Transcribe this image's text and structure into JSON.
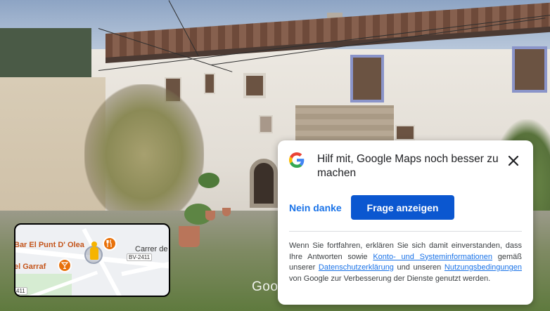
{
  "street_view": {
    "watermark": "Google"
  },
  "minimap": {
    "labels": {
      "bar_name": "Bar El Punt D' Olea",
      "garraf": "el Garraf",
      "street": "Carrer de",
      "road_badge": "BV-2411",
      "road_badge_left": "411"
    },
    "pin_icons": [
      "restaurant-icon",
      "bar-icon"
    ]
  },
  "dialog": {
    "title": "Hilf mit, Google Maps noch besser zu machen",
    "decline_label": "Nein danke",
    "accept_label": "Frage anzeigen",
    "legal": {
      "t1": "Wenn Sie fortfahren, erklären Sie sich damit einverstanden, dass Ihre Antworten sowie ",
      "link1": "Konto- und Systeminformationen",
      "t2": " gemäß unserer ",
      "link2": "Datenschutzerklärung",
      "t3": " und unseren ",
      "link3": "Nutzungsbedingungen",
      "t4": " von Google zur Verbesserung der Dienste genutzt werden."
    }
  },
  "colors": {
    "primary_button": "#0b57d0",
    "link": "#1a73e8",
    "map_pin": "#e8710a",
    "pegman": "#f6b400"
  }
}
